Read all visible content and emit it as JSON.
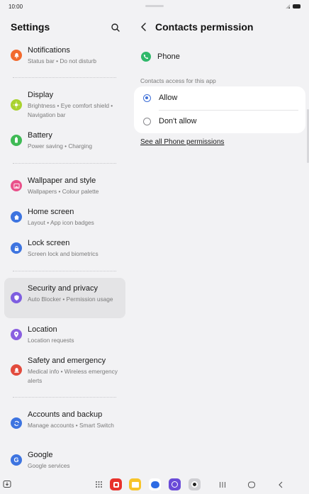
{
  "status_bar": {
    "time": "10:00"
  },
  "left_pane": {
    "title": "Settings",
    "items": [
      {
        "title": "Notifications",
        "subtitle": "Status bar  •  Do not disturb",
        "icon": "bell-icon",
        "color": "#f26a2e"
      },
      {
        "title": "Display",
        "subtitle": "Brightness  •  Eye comfort shield  •  Navigation bar",
        "icon": "sun-icon",
        "color": "#a9d22e"
      },
      {
        "title": "Battery",
        "subtitle": "Power saving  •  Charging",
        "icon": "battery-icon",
        "color": "#3fba55"
      },
      {
        "title": "Wallpaper and style",
        "subtitle": "Wallpapers  •  Colour palette",
        "icon": "wallpaper-icon",
        "color": "#e9508a"
      },
      {
        "title": "Home screen",
        "subtitle": "Layout  •  App icon badges",
        "icon": "home-icon",
        "color": "#3d74e0"
      },
      {
        "title": "Lock screen",
        "subtitle": "Screen lock and biometrics",
        "icon": "lock-icon",
        "color": "#3d74e0"
      },
      {
        "title": "Security and privacy",
        "subtitle": "Auto Blocker  •  Permission usage",
        "icon": "shield-icon",
        "color": "#7e5ee0"
      },
      {
        "title": "Location",
        "subtitle": "Location requests",
        "icon": "location-pin-icon",
        "color": "#8a5fe0"
      },
      {
        "title": "Safety and emergency",
        "subtitle": "Medical info  •  Wireless emergency alerts",
        "icon": "emergency-bell-icon",
        "color": "#e24b3d"
      },
      {
        "title": "Accounts and backup",
        "subtitle": "Manage accounts  •  Smart Switch",
        "icon": "sync-icon",
        "color": "#3d74e0"
      },
      {
        "title": "Google",
        "subtitle": "Google services",
        "icon": "google-icon",
        "color": "#3d74e0"
      }
    ]
  },
  "right_pane": {
    "title": "Contacts permission",
    "app_name": "Phone",
    "section_header": "Contacts access for this app",
    "options": [
      {
        "label": "Allow",
        "selected": true
      },
      {
        "label": "Don't allow",
        "selected": false
      }
    ],
    "link": "See all Phone permissions"
  },
  "nav_bar": {
    "dock_apps": [
      "app-drawer-icon",
      "flipboard-icon",
      "notes-icon",
      "messages-icon",
      "internet-icon",
      "camera-icon"
    ],
    "buttons": [
      "recents-button",
      "home-button",
      "back-button"
    ]
  }
}
